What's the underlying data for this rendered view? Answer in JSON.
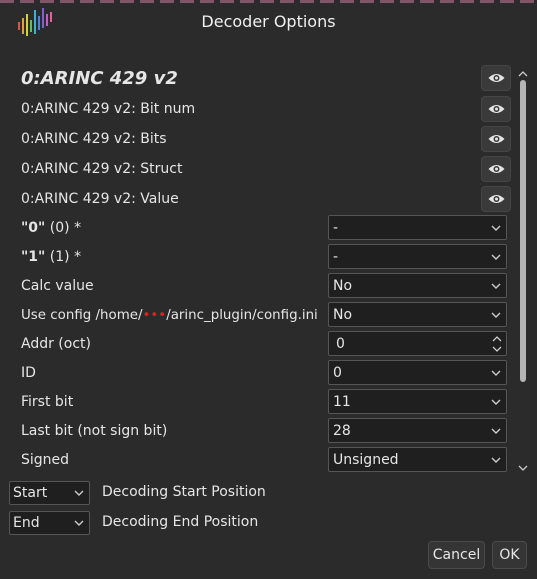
{
  "window": {
    "title": "Decoder Options"
  },
  "decoder": {
    "title": "0:ARINC 429 v2",
    "rows": [
      {
        "label": "0:ARINC 429 v2: Bit num"
      },
      {
        "label": "0:ARINC 429 v2: Bits"
      },
      {
        "label": "0:ARINC 429 v2: Struct"
      },
      {
        "label": "0:ARINC 429 v2: Value"
      }
    ]
  },
  "options": {
    "ch0": {
      "label_bold": "\"0\"",
      "label_rest": " (0) *",
      "value": "-"
    },
    "ch1": {
      "label_bold": "\"1\"",
      "label_rest": " (1) *",
      "value": "-"
    },
    "calc_value": {
      "label": "Calc value",
      "value": "No"
    },
    "use_config": {
      "label_pre": "Use config /home/",
      "label_redacted": "•••",
      "label_post": "/arinc_plugin/config.ini",
      "value": "No"
    },
    "addr": {
      "label": "Addr (oct)",
      "value": "0"
    },
    "id": {
      "label": "ID",
      "value": "0"
    },
    "first_bit": {
      "label": "First bit",
      "value": "11"
    },
    "last_bit": {
      "label": "Last bit (not sign bit)",
      "value": "28"
    },
    "signed": {
      "label": "Signed",
      "value": "Unsigned"
    }
  },
  "positions": {
    "start": {
      "select": "Start",
      "label": "Decoding Start Position"
    },
    "end": {
      "select": "End",
      "label": "Decoding End Position"
    }
  },
  "buttons": {
    "cancel": "Cancel",
    "ok": "OK"
  },
  "colors": {
    "background": "#2b2b2b",
    "field_bg": "#1f1f1f",
    "text": "#e6e6e6"
  }
}
